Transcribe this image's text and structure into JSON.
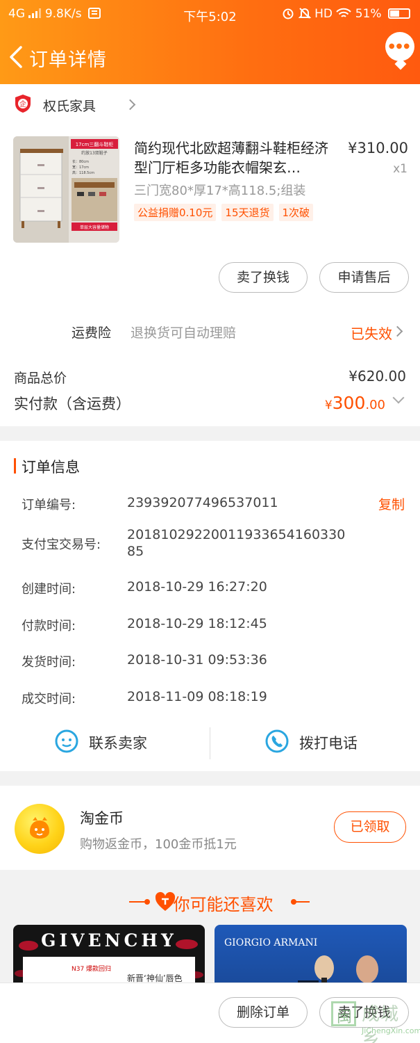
{
  "status_bar": {
    "network": "4G",
    "speed": "9.8K/s",
    "time": "下午5:02",
    "hd": "HD",
    "battery": "51%",
    "battery_level": 0.51
  },
  "header": {
    "title": "订单详情"
  },
  "shop": {
    "name": "权氏家具",
    "badge": "企"
  },
  "product": {
    "title": "简约现代北欧超薄翻斗鞋柜经济型门厅柜多功能衣帽架玄…",
    "price": "¥310.00",
    "quantity": "x1",
    "spec": "三门宽80*厚17*高118.5;组装",
    "tags": [
      "公益捐赠0.10元",
      "15天退货",
      "1次破"
    ],
    "image_texts": [
      "17cm三翻斗鞋柜",
      "约放13双鞋子",
      "长：80cm",
      "宽：17cm",
      "高：118.5cm",
      "单层大容量储物"
    ]
  },
  "actions": {
    "sell": "卖了换钱",
    "after_sale": "申请售后"
  },
  "insurance": {
    "label": "运费险",
    "desc": "退换货可自动理赔",
    "status": "已失效"
  },
  "summary": {
    "total_label": "商品总价",
    "total_value": "¥620.00",
    "paid_label": "实付款（含运费）",
    "paid_yen": "¥",
    "paid_int": "300",
    "paid_dec": ".00"
  },
  "order_info": {
    "title": "订单信息",
    "copy": "复制",
    "rows": [
      {
        "label": "订单编号:",
        "value": "239392077496537011"
      },
      {
        "label": "支付宝交易号:",
        "value": "20181029220011933654160330 85"
      },
      {
        "label": "创建时间:",
        "value": "2018-10-29 16:27:20"
      },
      {
        "label": "付款时间:",
        "value": "2018-10-29 18:12:45"
      },
      {
        "label": "发货时间:",
        "value": "2018-10-31 09:53:36"
      },
      {
        "label": "成交时间:",
        "value": "2018-11-09 08:18:19"
      }
    ],
    "contact_seller": "联系卖家",
    "call_phone": "拨打电话"
  },
  "coins": {
    "title": "淘金币",
    "subtitle": "购物返金币，100金币抵1元",
    "button": "已领取"
  },
  "recommend": {
    "title": "你可能还喜欢",
    "ads": [
      {
        "brand": "GIVENCHY",
        "line1": "N37 爆款回归",
        "line2": "新晋‘神仙’唇色"
      },
      {
        "brand": "GIORGIO ARMANI"
      }
    ]
  },
  "bottom": {
    "delete": "删除订单",
    "sell": "卖了换钱"
  },
  "watermark": {
    "text": "成城乡",
    "box": "闽",
    "url": "JiChengXin.com"
  },
  "colors": {
    "accent": "#ff5000",
    "header_start": "#ff9a16",
    "header_end": "#ff5a0f",
    "coin": "#ffd319"
  }
}
